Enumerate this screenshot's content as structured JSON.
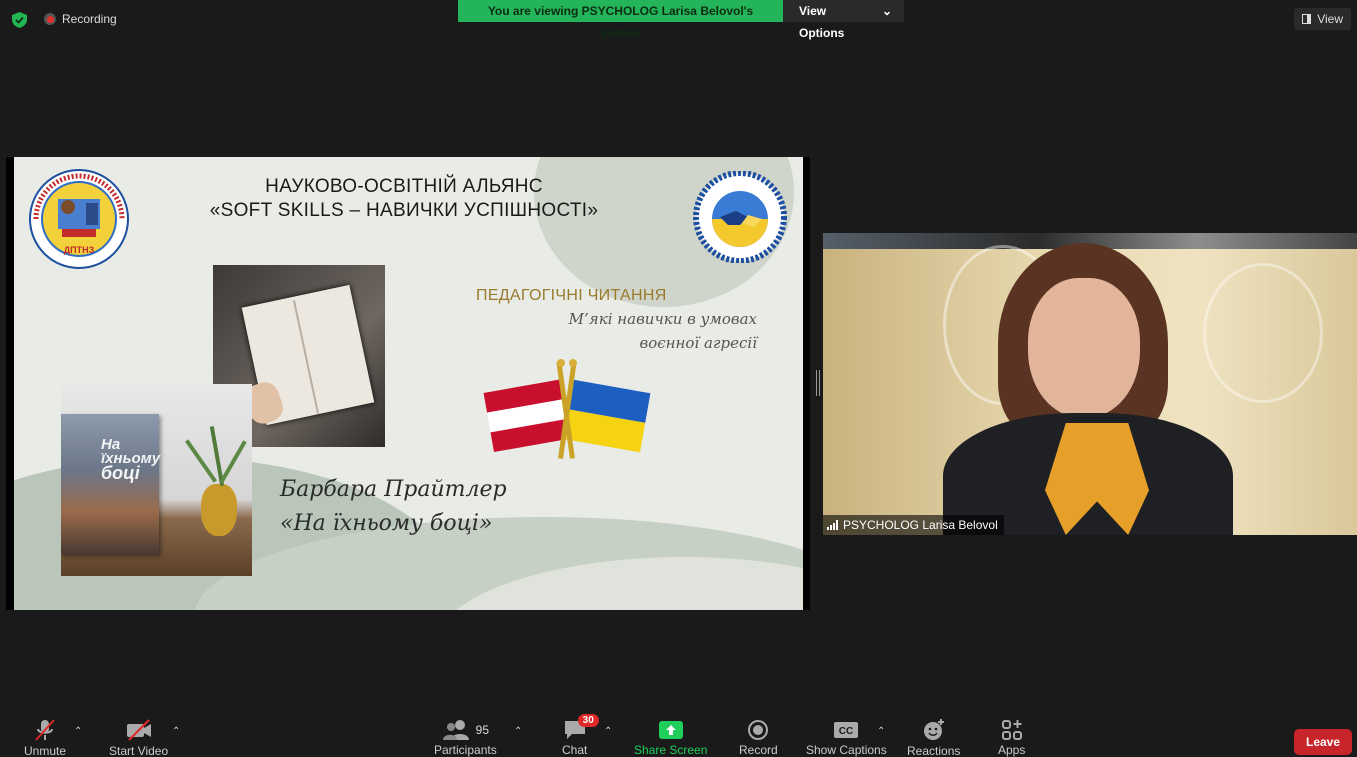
{
  "top_bar": {
    "recording_label": "Recording",
    "banner_text": "You are viewing PSYCHOLOG Larisa Belovol's screen",
    "view_options_label": "View Options",
    "view_label": "View",
    "shield_icon": "shield-check-icon",
    "colors": {
      "banner_green": "#24b55a",
      "record_red": "#e02f2f"
    }
  },
  "slide": {
    "title_line1": "НАУКОВО-ОСВІТНІЙ АЛЬЯНС",
    "title_line2": "«SOFT SKILLS – НАВИЧКИ УСПІШНОСТІ»",
    "left_logo_text_arc": "ФАХОВИЙ ПРОФЕСІЙНЕ УЧИЛИЩЕ БУДІВНИЦТВА І ДИЗАЙНУ",
    "left_logo_abbr": "ДПТНЗ",
    "right_logo_text_arc": "НАУКОВО-ОСВІТНІЙ АЛЬЯНС «SOFT SKILLS – НАВИЧКИ УСПІШНОСТІ»",
    "section_title": "ПЕДАГОГІЧНІ ЧИТАННЯ",
    "section_subtitle_line1": "М’які навички в умовах",
    "section_subtitle_line2": "воєнної агресії",
    "book_cover_title_line1": "На",
    "book_cover_title_line2": "їхньому",
    "book_cover_title_line3": "боці",
    "author_line": "Барбара Прайтлер",
    "book_line": "«На їхньому боці»"
  },
  "video": {
    "participant_name": "PSYCHOLOG Larisa Belovol"
  },
  "toolbar": {
    "unmute_label": "Unmute",
    "start_video_label": "Start Video",
    "participants_count": "95",
    "participants_label": "Participants",
    "chat_label": "Chat",
    "chat_badge": "30",
    "share_screen_label": "Share Screen",
    "record_label": "Record",
    "show_captions_label": "Show Captions",
    "reactions_label": "Reactions",
    "apps_label": "Apps",
    "leave_label": "Leave",
    "colors": {
      "share_green": "#1fce5b",
      "leave_red": "#c8252a",
      "badge_red": "#e02828"
    }
  }
}
